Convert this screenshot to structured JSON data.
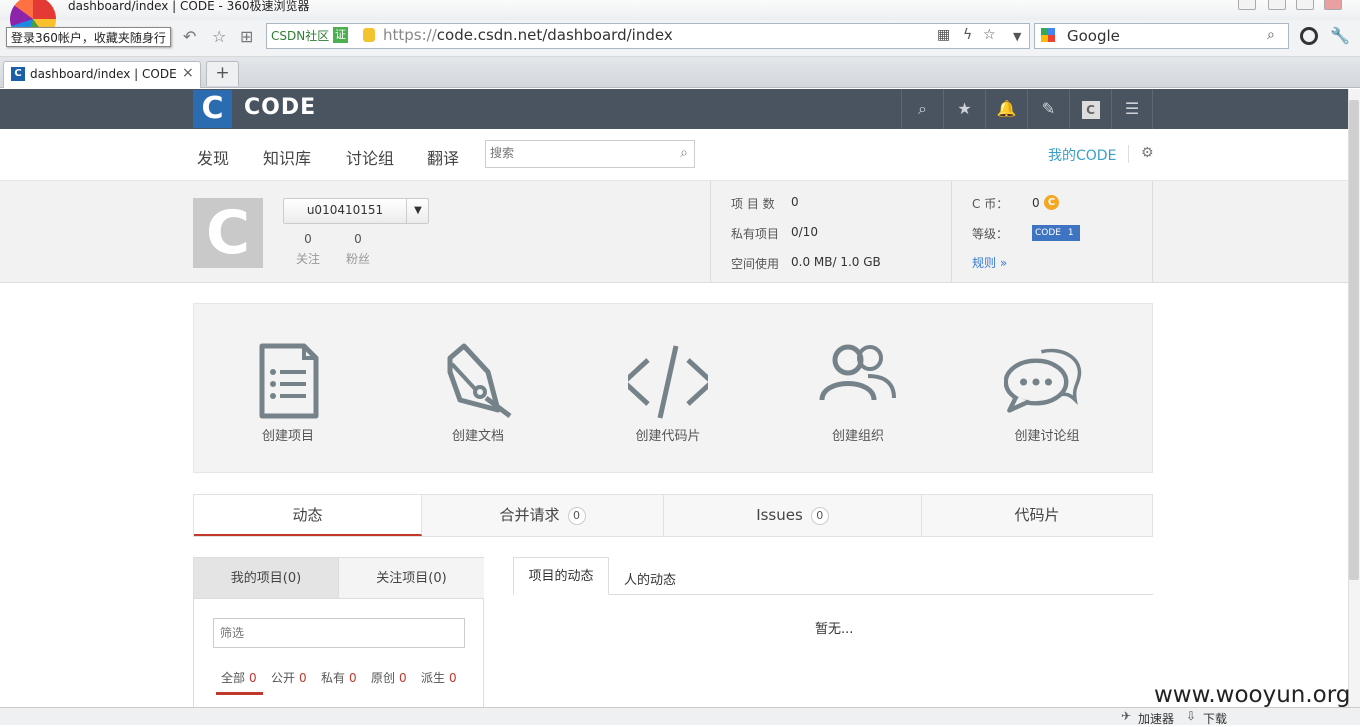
{
  "browser": {
    "window_title": "dashboard/index | CODE - 360极速浏览器",
    "tooltip": "登录360帐户，收藏夹随身行",
    "address_prefix": "CSDN社区",
    "cert_badge": "证",
    "url_scheme": "https://",
    "url_rest": "code.csdn.net/dashboard/index",
    "search_engine": "Google",
    "tab_title": "dashboard/index | CODE",
    "tab_close": "×",
    "new_tab": "+",
    "status_accelerator": "加速器",
    "status_download": "下载"
  },
  "site": {
    "logo_letter": "C",
    "name": "CODE",
    "nav": [
      "发现",
      "知识库",
      "讨论组",
      "翻译"
    ],
    "search_placeholder": "搜索",
    "my_code": "我的CODE"
  },
  "profile": {
    "avatar_letter": "C",
    "username": "u010410151",
    "follow_count": "0",
    "follow_label": "关注",
    "fans_count": "0",
    "fans_label": "粉丝",
    "project_count_label": "项 目 数",
    "project_count": "0",
    "private_label": "私有项目",
    "private_value": "0/10",
    "space_label": "空间使用",
    "space_value": "0.0 MB/ 1.0 GB",
    "coin_label": "C 币：",
    "coin_value": "0",
    "coin_icon": "C",
    "level_label": "等级：",
    "level_badge": "CODE",
    "level_value": "1",
    "rules_link": "规则 »"
  },
  "create": [
    "创建项目",
    "创建文档",
    "创建代码片",
    "创建组织",
    "创建讨论组"
  ],
  "tabs": [
    {
      "label": "动态"
    },
    {
      "label": "合并请求",
      "count": "0"
    },
    {
      "label": "Issues",
      "count": "0"
    },
    {
      "label": "代码片"
    }
  ],
  "projects": {
    "tab_mine": "我的项目(0)",
    "tab_watch": "关注项目(0)",
    "filter_placeholder": "筛选",
    "filters": [
      {
        "label": "全部",
        "count": "0"
      },
      {
        "label": "公开",
        "count": "0"
      },
      {
        "label": "私有",
        "count": "0"
      },
      {
        "label": "原创",
        "count": "0"
      },
      {
        "label": "派生",
        "count": "0"
      }
    ]
  },
  "activity": {
    "tab_projects": "项目的动态",
    "tab_people": "人的动态",
    "empty": "暂无..."
  },
  "watermark": "www.wooyun.org"
}
